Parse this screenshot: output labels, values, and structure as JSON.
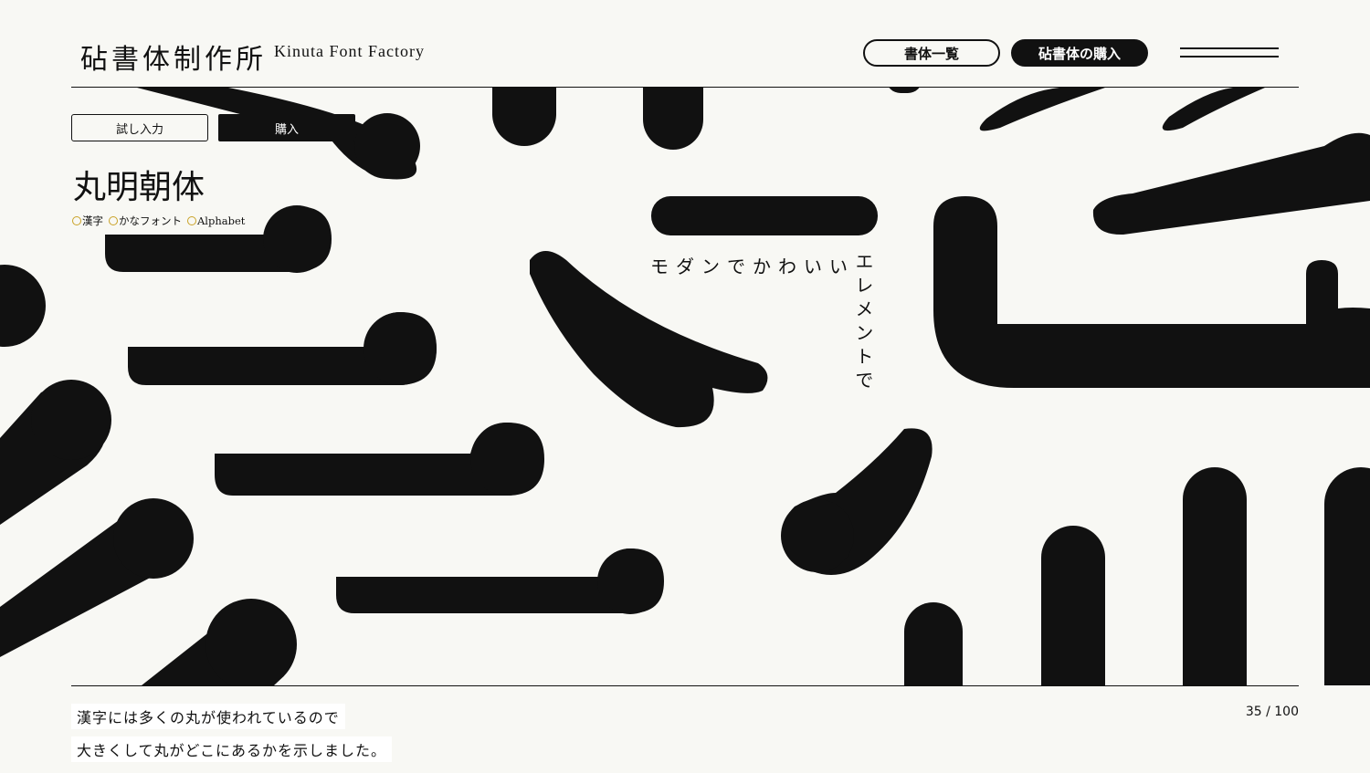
{
  "header": {
    "brand_jp": "砧書体制作所",
    "brand_en": "Kinuta Font Factory",
    "catalog_label": "書体一覧",
    "purchase_label": "砧書体の購入",
    "menu_icon": "hamburger-icon"
  },
  "controls": {
    "try_label": "試し入力",
    "buy_label": "購入"
  },
  "font": {
    "name": "丸明朝体",
    "scripts": [
      "漢字",
      "かなフォント",
      "Alphabet"
    ]
  },
  "artwork": {
    "horizontal_text": "モダンでかわいい",
    "vertical_text": "エレメントで"
  },
  "footer": {
    "caption_line1": "漢字には多くの丸が使われているので",
    "caption_line2": "大きくして丸がどこにあるかを示しました。",
    "counter": "35 / 100"
  },
  "colors": {
    "background": "#f8f8f4",
    "ink": "#111111",
    "accent_ring": "#c9a227"
  }
}
